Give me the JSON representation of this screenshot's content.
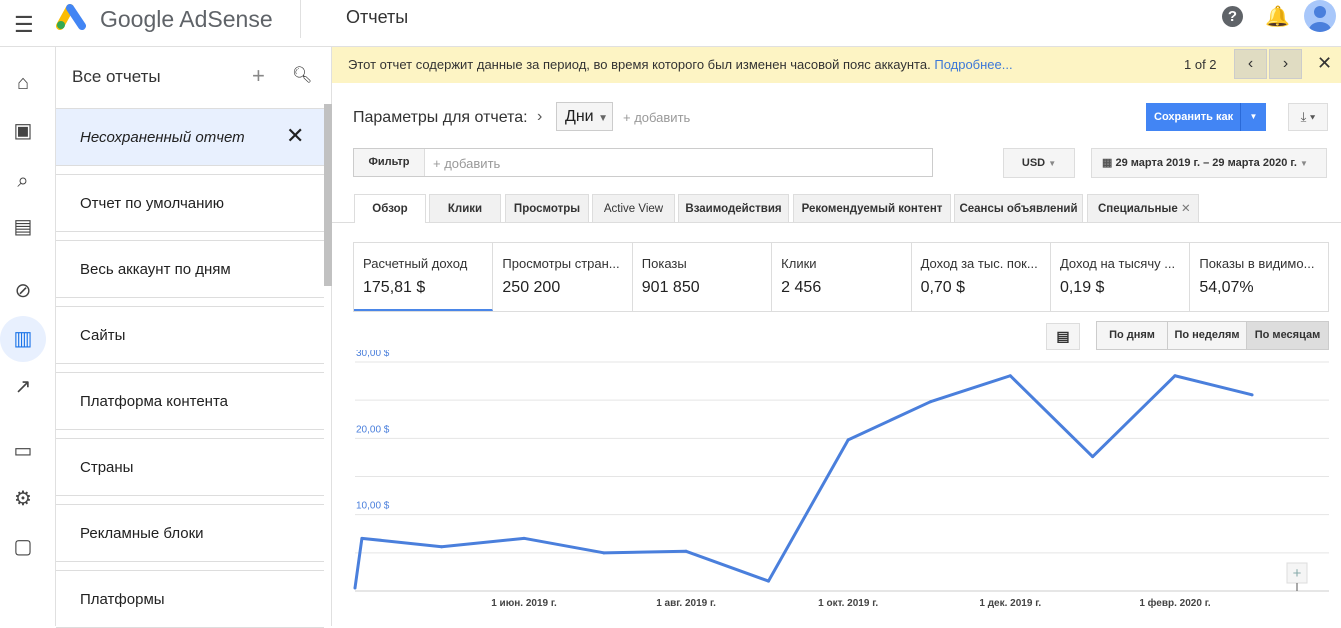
{
  "header": {
    "brand": "Google AdSense",
    "title": "Отчеты",
    "menu_icon": "menu-icon",
    "help_icon": "help-icon",
    "bell_icon": "bell-icon"
  },
  "rail": [
    "home-icon",
    "ads-icon",
    "search-preview-icon",
    "layout-icon",
    "block-icon",
    "reports-icon",
    "trending-icon",
    "payments-icon",
    "settings-icon",
    "feedback-icon"
  ],
  "panel": {
    "title": "Все отчеты",
    "unsaved": "Несохраненный отчет",
    "reports": [
      "Отчет по умолчанию",
      "Весь аккаунт по дням",
      "Сайты",
      "Платформа контента",
      "Страны",
      "Рекламные блоки",
      "Платформы"
    ]
  },
  "banner": {
    "text": "Этот отчет содержит данные за период, во время которого был изменен часовой пояс аккаунта.",
    "link": "Подробнее...",
    "page": "1 of 2",
    "bg": "#fdf4c4"
  },
  "params": {
    "label": "Параметры для отчета:",
    "dimension": "Дни",
    "add": "+ добавить",
    "save": "Сохранить как",
    "accent": "#4285f4"
  },
  "filter": {
    "label": "Фильтр",
    "placeholder": "+ добавить",
    "currency": "USD",
    "date_range": "29 марта 2019 г. – 29 марта 2020 г."
  },
  "tabs": [
    "Обзор",
    "Клики",
    "Просмотры",
    "Active View",
    "Взаимодействия",
    "Рекомендуемый контент",
    "Сеансы объявлений",
    "Специальные"
  ],
  "metrics": [
    {
      "name": "Расчетный доход",
      "value": "175,81 $"
    },
    {
      "name": "Просмотры стран...",
      "value": "250 200"
    },
    {
      "name": "Показы",
      "value": "901 850"
    },
    {
      "name": "Клики",
      "value": "2 456"
    },
    {
      "name": "Доход за тыс. пок...",
      "value": "0,70 $"
    },
    {
      "name": "Доход на тысячу ...",
      "value": "0,19 $"
    },
    {
      "name": "Показы в видимо...",
      "value": "54,07%"
    }
  ],
  "granularity": [
    "По дням",
    "По неделям",
    "По месяцам"
  ],
  "granularity_selected": "По месяцам",
  "chart_data": {
    "type": "line",
    "x": [
      "2019-03-29",
      "2019-04-01",
      "2019-05-01",
      "2019-06-01",
      "2019-07-01",
      "2019-08-01",
      "2019-09-01",
      "2019-10-01",
      "2019-11-01",
      "2019-12-01",
      "2020-01-01",
      "2020-02-01",
      "2020-03-01"
    ],
    "values": [
      0.4,
      6.9,
      5.8,
      6.9,
      5.0,
      5.2,
      1.3,
      19.8,
      24.8,
      28.2,
      17.6,
      28.2,
      25.7
    ],
    "ylim": [
      0,
      30
    ],
    "yticks": [
      "10,00 $",
      "20,00 $",
      "30,00 $"
    ],
    "xticks": [
      {
        "date": "2019-06-01",
        "label": "1 июн. 2019 г."
      },
      {
        "date": "2019-08-01",
        "label": "1 авг. 2019 г."
      },
      {
        "date": "2019-10-01",
        "label": "1 окт. 2019 г."
      },
      {
        "date": "2019-12-01",
        "label": "1 дек. 2019 г."
      },
      {
        "date": "2020-02-01",
        "label": "1 февр. 2020 г."
      }
    ],
    "color": "#4a7fdc",
    "grid": true
  }
}
